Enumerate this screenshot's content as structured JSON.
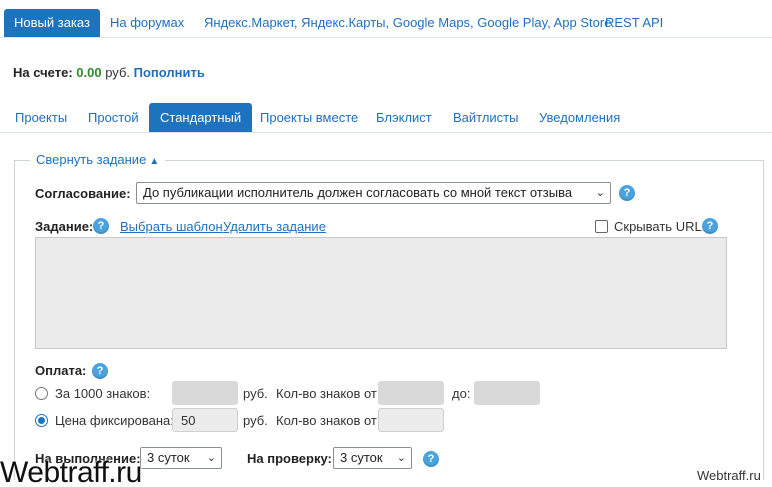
{
  "top_tabs": [
    {
      "label": "Новый заказ",
      "active": true
    },
    {
      "label": "На форумах",
      "active": false
    },
    {
      "label": "Яндекс.Маркет, Яндекс.Карты, Google Maps, Google Play, App Store",
      "active": false
    },
    {
      "label": "REST API",
      "active": false
    }
  ],
  "balance": {
    "label": "На счете:",
    "amount": "0.00",
    "currency": "руб.",
    "topup_link": "Пополнить"
  },
  "sub_tabs": [
    {
      "label": "Проекты",
      "active": false
    },
    {
      "label": "Простой",
      "active": false
    },
    {
      "label": "Стандартный",
      "active": true
    },
    {
      "label": "Проекты вместе",
      "active": false
    },
    {
      "label": "Блэклист",
      "active": false
    },
    {
      "label": "Вайтлисты",
      "active": false
    },
    {
      "label": "Уведомления",
      "active": false
    }
  ],
  "task_section": {
    "collapse_link": "Свернуть задание",
    "collapse_glyph": "▲",
    "approval": {
      "label": "Согласование:",
      "selected": "До публикации исполнитель должен согласовать со мной текст отзыва"
    },
    "task": {
      "label": "Задание:",
      "choose_template": "Выбрать шаблон",
      "delete_task": "Удалить задание",
      "hide_url_label": "Скрывать URL",
      "hide_url_checked": false,
      "text": ""
    },
    "payment": {
      "label": "Оплата:",
      "per_1000": {
        "label": "За 1000 знаков:",
        "selected": false,
        "price": "",
        "currency": "руб.",
        "chars_from_label": "Кол-во знаков от:",
        "chars_from": "",
        "to_label": "до:",
        "chars_to": ""
      },
      "fixed": {
        "label": "Цена фиксирована:",
        "selected": true,
        "price": "50",
        "currency": "руб.",
        "chars_from_label": "Кол-во знаков от:",
        "chars_from": ""
      }
    },
    "deadline": {
      "label": "На выполнение:",
      "selected": "3 суток"
    },
    "review": {
      "label": "На проверку:",
      "selected": "3 суток"
    }
  },
  "help_glyph": "?",
  "chevron_glyph": "⌄",
  "watermarks": {
    "left": "Webtraff.ru",
    "right": "Webtraff.ru"
  },
  "colors": {
    "accent": "#1e73be",
    "link": "#1f6fbf",
    "balance_amount": "#2e8b2e",
    "help_icon": "#4aa3df"
  }
}
